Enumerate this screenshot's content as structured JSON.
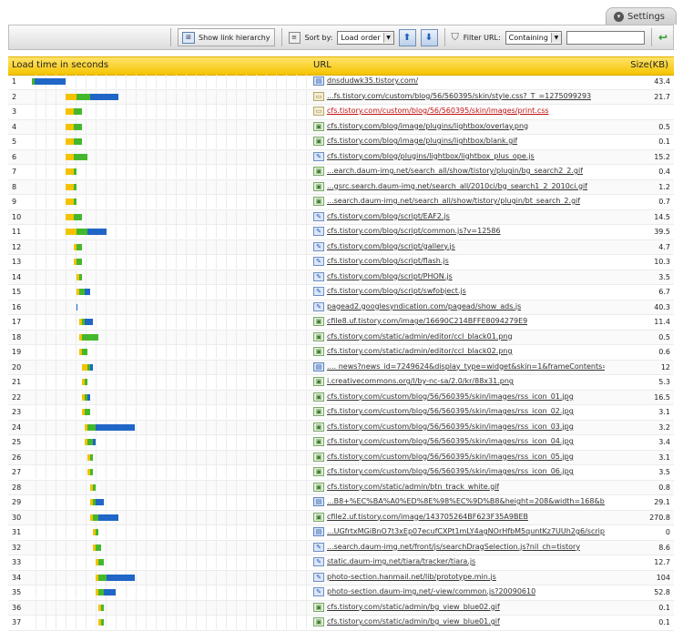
{
  "settings": {
    "label": "Settings",
    "arrow": "▾"
  },
  "toolbar": {
    "show_hierarchy": "Show link hierarchy",
    "sort_label": "Sort by:",
    "sort_value": "Load order",
    "filter_label": "Filter URL:",
    "filter_mode": "Containing",
    "filter_value": ""
  },
  "header": {
    "load_time": "Load time in seconds",
    "url": "URL",
    "size": "Size(KB)"
  },
  "colors": {
    "wait": "#f3c300",
    "connect": "#44b82c",
    "download": "#1f66c6",
    "header": "#f5c400"
  },
  "rows": [
    {
      "n": "1",
      "url": "dnsdudwk35.tistory.com/",
      "size": "43.4",
      "icon": "html",
      "start": 2,
      "wait": 0,
      "green": 1,
      "blue": 11
    },
    {
      "n": "2",
      "url": "...fs.tistory.com/custom/blog/56/560395/skin/style.css?_T_=1275099293",
      "size": "21.7",
      "icon": "css",
      "start": 14,
      "wait": 4,
      "green": 5,
      "blue": 10
    },
    {
      "n": "3",
      "url": "cfs.tistory.com/custom/blog/56/560395/skin/images/print.css",
      "size": "",
      "icon": "css",
      "start": 14,
      "wait": 3,
      "green": 3,
      "blue": 0,
      "err": true
    },
    {
      "n": "4",
      "url": "cfs.tistory.com/blog/image/plugins/lightbox/overlay.png",
      "size": "0.5",
      "icon": "png",
      "start": 14,
      "wait": 3,
      "green": 3,
      "blue": 0
    },
    {
      "n": "5",
      "url": "cfs.tistory.com/blog/image/plugins/lightbox/blank.gif",
      "size": "0.1",
      "icon": "gif",
      "start": 14,
      "wait": 3,
      "green": 3,
      "blue": 0
    },
    {
      "n": "6",
      "url": "cfs.tistory.com/blog/plugins/lightbox/lightbox_plus_ope.js",
      "size": "15.2",
      "icon": "js",
      "start": 14,
      "wait": 3,
      "green": 5,
      "blue": 0
    },
    {
      "n": "7",
      "url": "...earch.daum-img.net/search_all/show/tistory/plugin/bg_search2_2.gif",
      "size": "0.4",
      "icon": "gif",
      "start": 14,
      "wait": 3,
      "green": 1,
      "blue": 0
    },
    {
      "n": "8",
      "url": "...gsrc.search.daum-img.net/search_all/2010ci/bg_search1_2_2010ci.gif",
      "size": "1.2",
      "icon": "gif",
      "start": 14,
      "wait": 3,
      "green": 1,
      "blue": 0
    },
    {
      "n": "9",
      "url": "...search.daum-img.net/search_all/show/tistory/plugin/bt_search_2.gif",
      "size": "0.7",
      "icon": "gif",
      "start": 14,
      "wait": 3,
      "green": 1,
      "blue": 0
    },
    {
      "n": "10",
      "url": "cfs.tistory.com/blog/script/EAF2.js",
      "size": "14.5",
      "icon": "js",
      "start": 14,
      "wait": 3,
      "green": 3,
      "blue": 0
    },
    {
      "n": "11",
      "url": "cfs.tistory.com/blog/script/common.js?v=12586",
      "size": "39.5",
      "icon": "js",
      "start": 14,
      "wait": 4,
      "green": 4,
      "blue": 7
    },
    {
      "n": "12",
      "url": "cfs.tistory.com/blog/script/gallery.js",
      "size": "4.7",
      "icon": "js",
      "start": 17,
      "wait": 1,
      "green": 2,
      "blue": 0
    },
    {
      "n": "13",
      "url": "cfs.tistory.com/blog/script/flash.js",
      "size": "10.3",
      "icon": "js",
      "start": 17,
      "wait": 1,
      "green": 2,
      "blue": 0
    },
    {
      "n": "14",
      "url": "cfs.tistory.com/blog/script/PHON.js",
      "size": "3.5",
      "icon": "js",
      "start": 18,
      "wait": 1,
      "green": 1,
      "blue": 0
    },
    {
      "n": "15",
      "url": "cfs.tistory.com/blog/script/swfobject.js",
      "size": "6.7",
      "icon": "js",
      "start": 18,
      "wait": 1,
      "green": 2,
      "blue": 2
    },
    {
      "n": "16",
      "url": "pagead2.googlesyndication.com/pagead/show_ads.js",
      "size": "40.3",
      "icon": "js",
      "start": 18,
      "wait": 0,
      "green": 0,
      "blue": 0.3
    },
    {
      "n": "17",
      "url": "cfile8.uf.tistory.com/image/16690C214BFFE8094279E9",
      "size": "11.4",
      "icon": "png",
      "start": 19,
      "wait": 1,
      "green": 1,
      "blue": 3
    },
    {
      "n": "18",
      "url": "cfs.tistory.com/static/admin/editor/ccl_black01.png",
      "size": "0.5",
      "icon": "png",
      "start": 19,
      "wait": 1,
      "green": 6,
      "blue": 0
    },
    {
      "n": "19",
      "url": "cfs.tistory.com/static/admin/editor/ccl_black02.png",
      "size": "0.6",
      "icon": "png",
      "start": 19,
      "wait": 1,
      "green": 2,
      "blue": 0
    },
    {
      "n": "20",
      "url": ".... news?news_id=7249624&display_type=widget&skin=1&frameContents=rel",
      "size": "12",
      "icon": "html",
      "start": 20,
      "wait": 2,
      "green": 1,
      "blue": 1
    },
    {
      "n": "21",
      "url": "i.creativecommons.org/l/by-nc-sa/2.0/kr/88x31.png",
      "size": "5.3",
      "icon": "png",
      "start": 20,
      "wait": 1,
      "green": 1,
      "blue": 0
    },
    {
      "n": "22",
      "url": "cfs.tistory.com/custom/blog/56/560395/skin/images/rss_icon_01.jpg",
      "size": "16.5",
      "icon": "jpg",
      "start": 20,
      "wait": 1,
      "green": 1,
      "blue": 1
    },
    {
      "n": "23",
      "url": "cfs.tistory.com/custom/blog/56/560395/skin/images/rss_icon_02.jpg",
      "size": "3.1",
      "icon": "jpg",
      "start": 20,
      "wait": 1,
      "green": 2,
      "blue": 0
    },
    {
      "n": "24",
      "url": "cfs.tistory.com/custom/blog/56/560395/skin/images/rss_icon_03.jpg",
      "size": "3.2",
      "icon": "jpg",
      "start": 21,
      "wait": 1,
      "green": 3,
      "blue": 14
    },
    {
      "n": "25",
      "url": "cfs.tistory.com/custom/blog/56/560395/skin/images/rss_icon_04.jpg",
      "size": "3.4",
      "icon": "jpg",
      "start": 21,
      "wait": 1,
      "green": 2,
      "blue": 1
    },
    {
      "n": "26",
      "url": "cfs.tistory.com/custom/blog/56/560395/skin/images/rss_icon_05.jpg",
      "size": "3.1",
      "icon": "jpg",
      "start": 22,
      "wait": 1,
      "green": 1,
      "blue": 0
    },
    {
      "n": "27",
      "url": "cfs.tistory.com/custom/blog/56/560395/skin/images/rss_icon_06.jpg",
      "size": "3.5",
      "icon": "jpg",
      "start": 22,
      "wait": 1,
      "green": 1,
      "blue": 0
    },
    {
      "n": "28",
      "url": "cfs.tistory.com/static/admin/btn_track_white.gif",
      "size": "0.8",
      "icon": "gif",
      "start": 23,
      "wait": 1,
      "green": 1,
      "blue": 0
    },
    {
      "n": "29",
      "url": "...B8+%EC%BA%A0%ED%8E%98%EC%9D%B8&height=208&width=168&border=simple",
      "size": "29.1",
      "icon": "html",
      "start": 23,
      "wait": 1,
      "green": 1,
      "blue": 3
    },
    {
      "n": "30",
      "url": "cfile2.uf.tistory.com/image/143705264BF623F35A9BEB",
      "size": "270.8",
      "icon": "png",
      "start": 23,
      "wait": 1,
      "green": 2,
      "blue": 7
    },
    {
      "n": "31",
      "url": "...UGfrtxMGiBnO7t3xEp07ecufCXPt1mLY4agNOrHfbM5quntKz7UUh2g6/script.js",
      "size": "0",
      "icon": "html",
      "start": 24,
      "wait": 1,
      "green": 1,
      "blue": 0
    },
    {
      "n": "32",
      "url": "...search.daum-img.net/front/js/searchDragSelection.js?nil_ch=tistory",
      "size": "8.6",
      "icon": "js",
      "start": 24,
      "wait": 1,
      "green": 2,
      "blue": 0
    },
    {
      "n": "33",
      "url": "static.daum-img.net/tiara/tracker/tiara.js",
      "size": "12.7",
      "icon": "js",
      "start": 25,
      "wait": 1,
      "green": 2,
      "blue": 0
    },
    {
      "n": "34",
      "url": "photo-section.hanmail.net/lib/prototype.min.js",
      "size": "104",
      "icon": "js",
      "start": 25,
      "wait": 1,
      "green": 3,
      "blue": 10
    },
    {
      "n": "35",
      "url": "photo-section.daum-img.net/-view/common.js?20090610",
      "size": "52.8",
      "icon": "js",
      "start": 25,
      "wait": 1,
      "green": 2,
      "blue": 4
    },
    {
      "n": "36",
      "url": "cfs.tistory.com/static/admin/bg_view_blue02.gif",
      "size": "0.1",
      "icon": "gif",
      "start": 26,
      "wait": 1,
      "green": 1,
      "blue": 0
    },
    {
      "n": "37",
      "url": "cfs.tistory.com/static/admin/bg_view_blue01.gif",
      "size": "0.1",
      "icon": "gif",
      "start": 26,
      "wait": 1,
      "green": 1,
      "blue": 0
    }
  ]
}
